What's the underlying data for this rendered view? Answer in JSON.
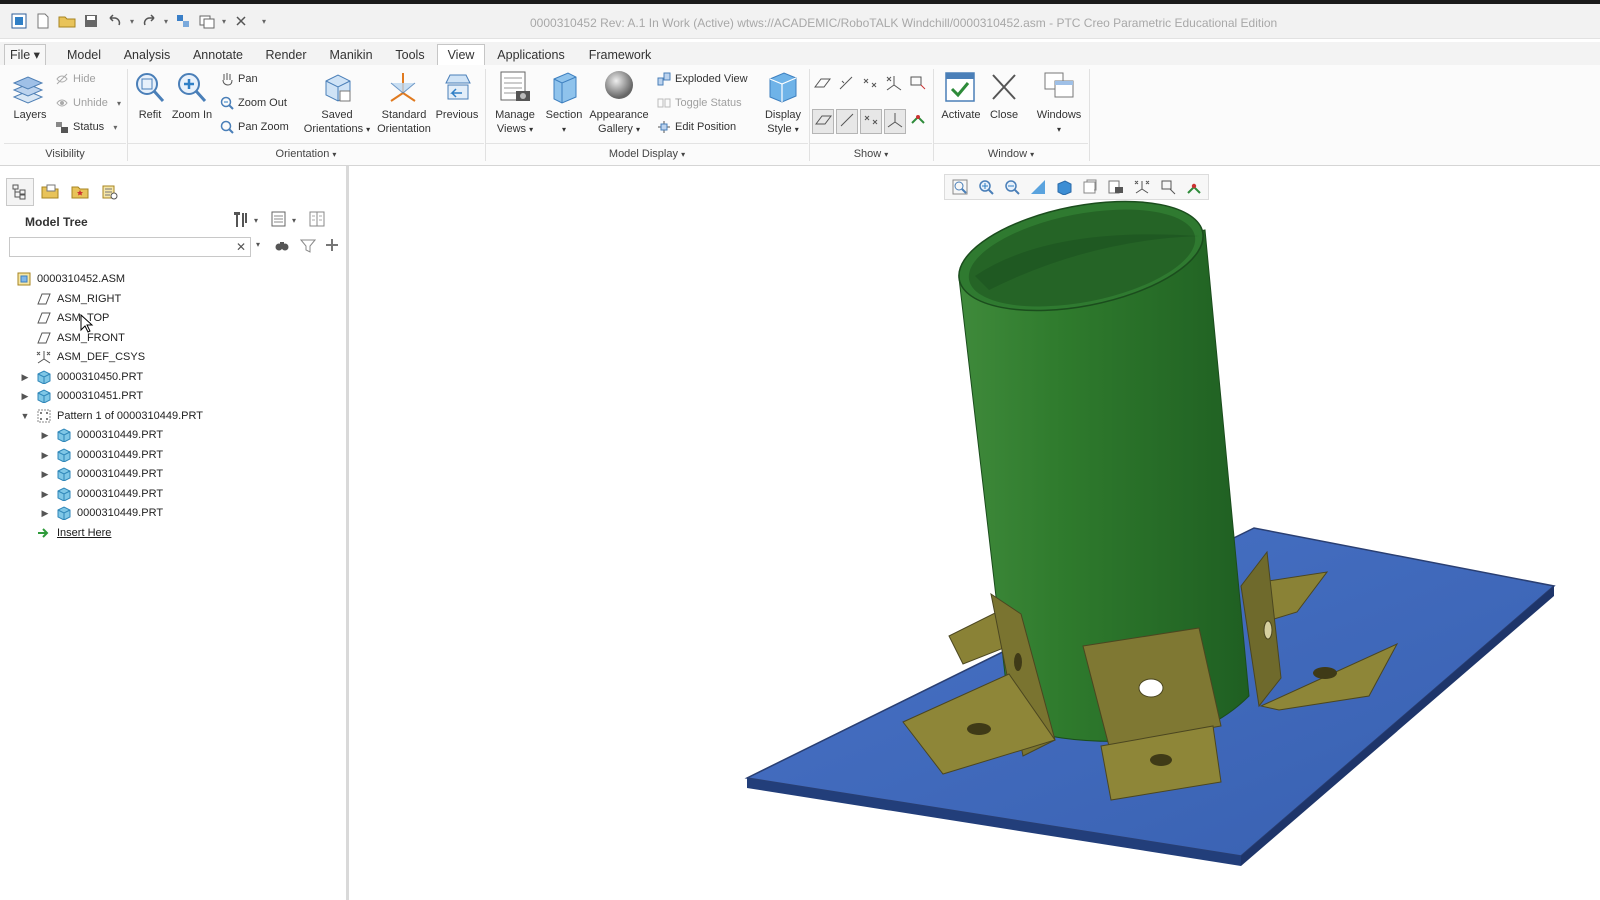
{
  "title": "0000310452 Rev: A.1 In Work  (Active) wtws://ACADEMIC/RoboTALK Windchill/0000310452.asm - PTC Creo Parametric Educational Edition",
  "tabs": [
    {
      "label": "File",
      "id": "file"
    },
    {
      "label": "Model",
      "id": "model"
    },
    {
      "label": "Analysis",
      "id": "analysis"
    },
    {
      "label": "Annotate",
      "id": "annotate"
    },
    {
      "label": "Render",
      "id": "render"
    },
    {
      "label": "Manikin",
      "id": "manikin"
    },
    {
      "label": "Tools",
      "id": "tools"
    },
    {
      "label": "View",
      "id": "view"
    },
    {
      "label": "Applications",
      "id": "applications"
    },
    {
      "label": "Framework",
      "id": "framework"
    }
  ],
  "active_tab": "View",
  "ribbon": {
    "visibility": {
      "layers": "Layers",
      "hide": "Hide",
      "unhide": "Unhide",
      "status": "Status",
      "group": "Visibility"
    },
    "orientation": {
      "refit": "Refit",
      "zoom_in": "Zoom In",
      "pan": "Pan",
      "zoom_out": "Zoom Out",
      "pan_zoom": "Pan Zoom",
      "saved_1": "Saved",
      "saved_2": "Orientations",
      "standard_1": "Standard",
      "standard_2": "Orientation",
      "previous": "Previous",
      "group": "Orientation"
    },
    "model_display": {
      "manage_1": "Manage",
      "manage_2": "Views",
      "section": "Section",
      "appearance_1": "Appearance",
      "appearance_2": "Gallery",
      "exploded": "Exploded View",
      "toggle": "Toggle Status",
      "edit_pos": "Edit Position",
      "display_1": "Display",
      "display_2": "Style",
      "group": "Model Display"
    },
    "show": {
      "group": "Show"
    },
    "window": {
      "activate": "Activate",
      "close": "Close",
      "windows": "Windows",
      "group": "Window"
    }
  },
  "model_tree": {
    "title": "Model Tree",
    "search_placeholder": "",
    "nodes": [
      {
        "label": "0000310452.ASM",
        "icon": "assembly-icon"
      },
      {
        "label": "ASM_RIGHT",
        "icon": "datum-plane-icon"
      },
      {
        "label": "ASM_TOP",
        "icon": "datum-plane-icon"
      },
      {
        "label": "ASM_FRONT",
        "icon": "datum-plane-icon"
      },
      {
        "label": "ASM_DEF_CSYS",
        "icon": "csys-icon"
      },
      {
        "label": "0000310450.PRT",
        "icon": "part-icon"
      },
      {
        "label": "0000310451.PRT",
        "icon": "part-icon"
      },
      {
        "label": "Pattern 1 of 0000310449.PRT",
        "icon": "pattern-icon"
      },
      {
        "label": "0000310449.PRT",
        "icon": "part-icon"
      },
      {
        "label": "0000310449.PRT",
        "icon": "part-icon"
      },
      {
        "label": "0000310449.PRT",
        "icon": "part-icon"
      },
      {
        "label": "0000310449.PRT",
        "icon": "part-icon"
      },
      {
        "label": "0000310449.PRT",
        "icon": "part-icon"
      },
      {
        "label": "Insert Here",
        "icon": "insert-arrow-icon"
      }
    ]
  },
  "colors": {
    "tube": "#2e7d32",
    "base_plate": "#3a63b5",
    "brackets": "#7a7430",
    "accent": "#2f7fc6"
  }
}
